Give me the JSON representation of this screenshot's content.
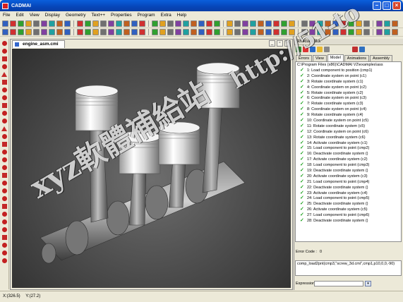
{
  "window": {
    "title": "CADMAI"
  },
  "menu": [
    "File",
    "Edit",
    "View",
    "Display",
    "Geometry",
    "Text++",
    "Properties",
    "Program",
    "Extra",
    "Help"
  ],
  "document": {
    "tab": "engine_asm.cmi"
  },
  "panel": {
    "title": "Struktureditor",
    "tabs": [
      "Errors",
      "View",
      "Model",
      "Animations",
      "Assembly"
    ],
    "tree_root": "C:\\Program Files (x86)\\CADMAI V2\\examples\\ass",
    "items": [
      "1: Load component to position (cmp1)",
      "2: Coordinate system on point (c1)",
      "3: Rotate coordinate system (c1)",
      "4: Coordinate system on point (c2)",
      "5: Rotate coordinate system (c2)",
      "6: Coordinate system on point (c3)",
      "7: Rotate coordinate system (c3)",
      "8: Coordinate system on point (c4)",
      "9: Rotate coordinate system (c4)",
      "10: Coordinate system on point (c5)",
      "11: Rotate coordinate system (c5)",
      "12: Coordinate system on point (c6)",
      "13: Rotate coordinate system (c6)",
      "14: Activate coordinate system (c1)",
      "15: Load component to point (cmp2)",
      "16: Deactivate coordinate system ()",
      "17: Activate coordinate system (c2)",
      "18: Load component to point (cmp3)",
      "19: Deactivate coordinate system ()",
      "20: Activate coordinate system (c3)",
      "21: Load component to point (cmp4)",
      "22: Deactivate coordinate system ()",
      "23: Activate coordinate system (c4)",
      "24: Load component to point (cmp5)",
      "25: Deactivate coordinate system ()",
      "26: Activate coordinate system (c5)",
      "27: Load component to point (cmp6)",
      "28: Deactivate coordinate system ()"
    ],
    "error_label": "Error Code :",
    "error_value": "0",
    "command": "comp_load2pnt(cmp3,\"screw_3d.cmi\",cmp1,p10,0,0,-90)",
    "expression_label": "Expression"
  },
  "status": {
    "x": "X:(326.5)",
    "y": "Y:(27.2)"
  },
  "watermark": {
    "line1": "xyz軟體補給站",
    "line2": "http://51-to"
  },
  "colors": {
    "title_bar": "#0645b8",
    "check": "#1fa31f",
    "piston": "#e0e0e0"
  }
}
